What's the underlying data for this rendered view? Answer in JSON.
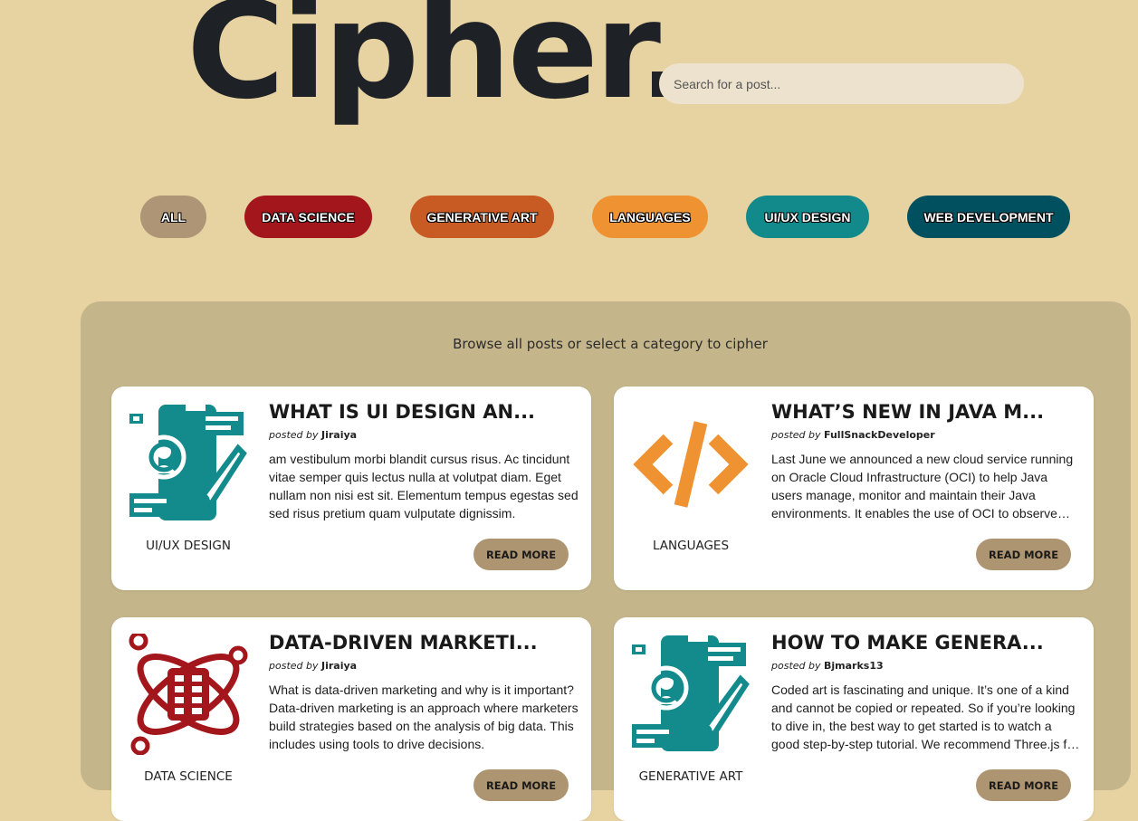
{
  "header": {
    "logo": "Cipher.",
    "search_placeholder": "Search for a post..."
  },
  "categories": [
    {
      "label": "ALL",
      "color": "#ad9575"
    },
    {
      "label": "DATA SCIENCE",
      "color": "#a3161b"
    },
    {
      "label": "GENERATIVE ART",
      "color": "#c85a23"
    },
    {
      "label": "LANGUAGES",
      "color": "#ee9232"
    },
    {
      "label": "UI/UX DESIGN",
      "color": "#128a8c"
    },
    {
      "label": "WEB DEVELOPMENT",
      "color": "#00505f"
    }
  ],
  "main": {
    "subtitle": "Browse all posts or select a category to cipher",
    "read_more_label": "READ MORE",
    "posted_by_label": "posted by",
    "posts": [
      {
        "title": "WHAT IS UI DESIGN AN...",
        "author": "Jiraiya",
        "category": "UI/UX DESIGN",
        "icon": "ui-ux-design-icon",
        "excerpt": "am vestibulum morbi blandit cursus risus. Ac tincidunt vitae semper quis lectus nulla at volutpat diam. Eget nullam non nisi est sit. Elementum tempus egestas sed sed risus pretium quam vulputate dignissim."
      },
      {
        "title": "WHAT’S NEW IN JAVA M...",
        "author": "FullSnackDeveloper",
        "category": "LANGUAGES",
        "icon": "code-brackets-icon",
        "excerpt": "Last June we announced a new cloud service running on Oracle Cloud Infrastructure (OCI) to help Java users manage, monitor and maintain their Java environments. It enables the use of OCI to observe and manage."
      },
      {
        "title": "DATA-DRIVEN MARKETI...",
        "author": "Jiraiya",
        "category": "DATA SCIENCE",
        "icon": "data-atom-icon",
        "excerpt": "What is data-driven marketing and why is it important? Data-driven marketing is an approach where marketers build strategies based on the analysis of big data. This includes using tools to drive decisions."
      },
      {
        "title": "HOW TO MAKE GENERA...",
        "author": "Bjmarks13",
        "category": "GENERATIVE ART",
        "icon": "ui-ux-design-icon",
        "excerpt": "Coded art is fascinating and unique. It’s one of a kind and cannot be copied or repeated. So if you’re looking to dive in, the best way to get started is to watch a good step-by-step tutorial. We recommend Three.js for beginners."
      }
    ]
  }
}
